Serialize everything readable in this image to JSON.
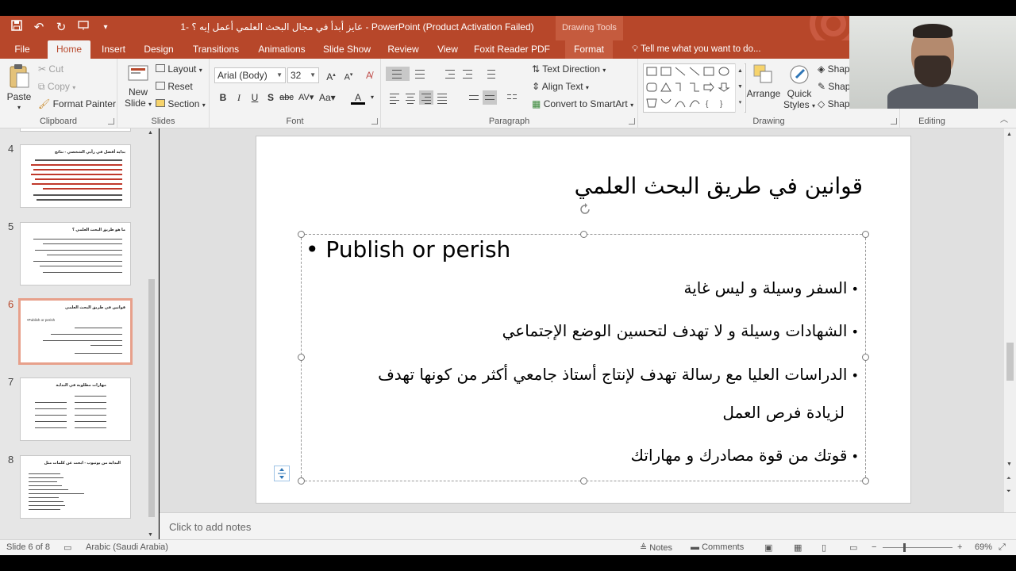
{
  "window": {
    "title": "1- عايز أبدأ في مجال البحث العلمي أعمل إيه ؟ - PowerPoint (Product Activation Failed)",
    "contextual_tab_group": "Drawing Tools"
  },
  "tabs": [
    {
      "label": "File"
    },
    {
      "label": "Home"
    },
    {
      "label": "Insert"
    },
    {
      "label": "Design"
    },
    {
      "label": "Transitions"
    },
    {
      "label": "Animations"
    },
    {
      "label": "Slide Show"
    },
    {
      "label": "Review"
    },
    {
      "label": "View"
    },
    {
      "label": "Foxit Reader PDF"
    },
    {
      "label": "Format"
    }
  ],
  "tell_me": "Tell me what you want to do...",
  "ribbon": {
    "clipboard": {
      "paste": "Paste",
      "cut": "Cut",
      "copy": "Copy",
      "format_painter": "Format Painter",
      "label": "Clipboard"
    },
    "slides": {
      "new_slide_1": "New",
      "new_slide_2": "Slide",
      "layout": "Layout",
      "reset": "Reset",
      "section": "Section",
      "label": "Slides"
    },
    "font": {
      "name": "Arial (Body)",
      "size": "32",
      "label": "Font"
    },
    "paragraph": {
      "text_direction": "Text Direction",
      "align_text": "Align Text",
      "convert_smartart": "Convert to SmartArt",
      "label": "Paragraph"
    },
    "drawing": {
      "arrange": "Arrange",
      "quick_styles_1": "Quick",
      "quick_styles_2": "Styles",
      "shape_fill": "Shap",
      "shape_outline": "Shap",
      "shape_effects": "Shap",
      "label": "Drawing"
    },
    "editing": {
      "label": "Editing"
    }
  },
  "thumbnails": [
    {
      "number": "4",
      "title": "بداية أفضل في رأيي الشخصي - نتائج"
    },
    {
      "number": "5",
      "title": "ما هو طريق البحث العلمي ؟"
    },
    {
      "number": "6",
      "title": "قوانين في طريق البحث العلمي",
      "subtitle": "•Publish or perish"
    },
    {
      "number": "7",
      "title": "مهارات مطلوبة في البداية"
    },
    {
      "number": "8",
      "title": "البداية من يوتيوب - ابحث عن كلمات مثل"
    }
  ],
  "slide": {
    "title": "قوانين في طريق البحث العلمي",
    "bullets": [
      "Publish or perish",
      "السفر وسيلة و ليس غاية",
      "الشهادات وسيلة و لا تهدف لتحسين الوضع الإجتماعي",
      "الدراسات العليا مع رسالة تهدف لإنتاج أستاذ جامعي أكثر من كونها تهدف",
      "لزيادة فرص العمل",
      "قوتك من قوة مصادرك و مهاراتك"
    ]
  },
  "notes_placeholder": "Click to add notes",
  "status": {
    "slide_info": "Slide 6 of 8",
    "language": "Arabic (Saudi Arabia)",
    "notes": "Notes",
    "comments": "Comments",
    "zoom": "69%"
  }
}
